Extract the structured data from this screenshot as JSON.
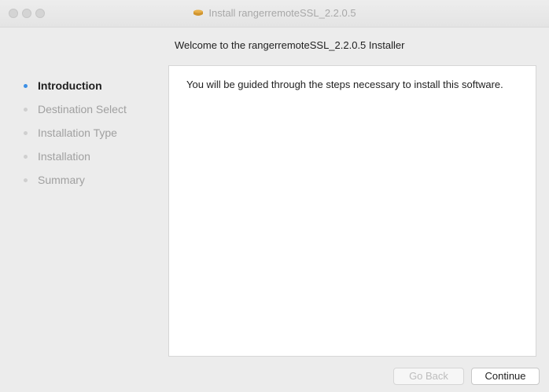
{
  "window": {
    "title": "Install rangerremoteSSL_2.2.0.5",
    "title_icon": "package-icon"
  },
  "heading": "Welcome to the rangerremoteSSL_2.2.0.5 Installer",
  "steps": [
    {
      "label": "Introduction",
      "state": "active"
    },
    {
      "label": "Destination Select",
      "state": "pending"
    },
    {
      "label": "Installation Type",
      "state": "pending"
    },
    {
      "label": "Installation",
      "state": "pending"
    },
    {
      "label": "Summary",
      "state": "pending"
    }
  ],
  "content": {
    "text": "You will be guided through the steps necessary to install this software."
  },
  "buttons": {
    "back": "Go Back",
    "continue": "Continue"
  },
  "colors": {
    "active_step": "#3b8ee5",
    "background": "#ececec"
  }
}
